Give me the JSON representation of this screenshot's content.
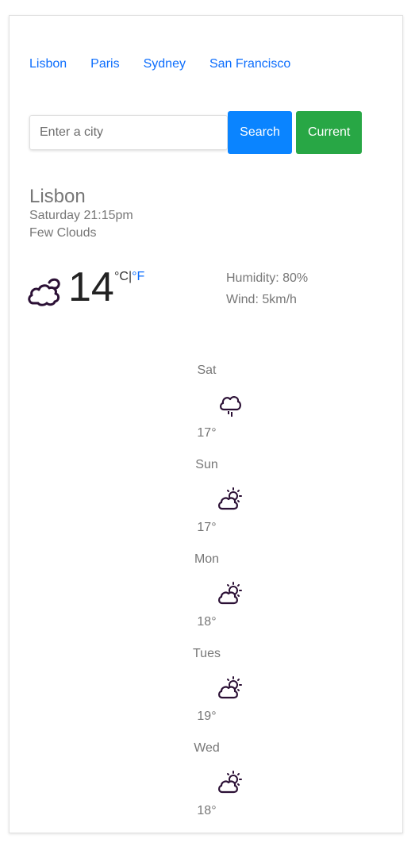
{
  "cities": [
    "Lisbon",
    "Paris",
    "Sydney",
    "San Francisco"
  ],
  "search": {
    "placeholder": "Enter a city",
    "value": "",
    "search_label": "Search",
    "current_label": "Current"
  },
  "current": {
    "city": "Lisbon",
    "date": "Saturday 21:15pm",
    "description": "Few Clouds",
    "temperature": "14",
    "unit_c": "°C",
    "separator": "|",
    "unit_f": "°F",
    "humidity": "Humidity: 80%",
    "wind": "Wind: 5km/h",
    "icon": "cloud-night-icon"
  },
  "forecast": [
    {
      "day": "Sat",
      "temp": "17°",
      "icon": "cloud-rain-icon"
    },
    {
      "day": "Sun",
      "temp": "17°",
      "icon": "sun-cloud-icon"
    },
    {
      "day": "Mon",
      "temp": "18°",
      "icon": "sun-cloud-icon"
    },
    {
      "day": "Tues",
      "temp": "19°",
      "icon": "sun-cloud-icon"
    },
    {
      "day": "Wed",
      "temp": "18°",
      "icon": "sun-cloud-icon"
    }
  ],
  "colors": {
    "link": "#0d6efd",
    "search_button": "#0a84ff",
    "current_button": "#28a745",
    "icon_stroke": "#2b1035"
  }
}
